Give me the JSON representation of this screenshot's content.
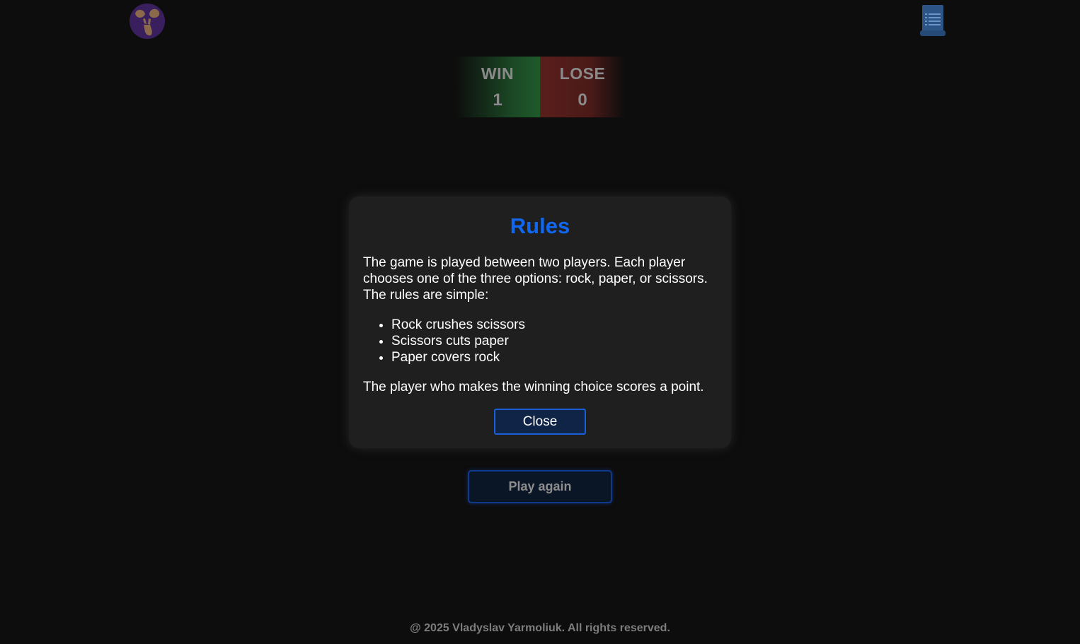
{
  "header": {
    "logo_icon": "rock-paper-scissors-hands-icon",
    "rules_icon": "scroll-list-icon"
  },
  "scoreboard": {
    "win_label": "WIN",
    "win_value": "1",
    "lose_label": "LOSE",
    "lose_value": "0",
    "win_color": "#1f5a2a",
    "lose_color": "#5a1e1b"
  },
  "modal": {
    "title": "Rules",
    "intro": "The game is played between two players. Each player chooses one of the three options: rock, paper, or scissors. The rules are simple:",
    "rules": [
      "Rock crushes scissors",
      "Scissors cuts paper",
      "Paper covers rock"
    ],
    "outro": "The player who makes the winning choice scores a point.",
    "close_label": "Close",
    "accent_color": "#1267f0"
  },
  "actions": {
    "play_again_label": "Play again"
  },
  "footer": {
    "text": "@ 2025 Vladyslav Yarmoliuk. All rights reserved."
  }
}
